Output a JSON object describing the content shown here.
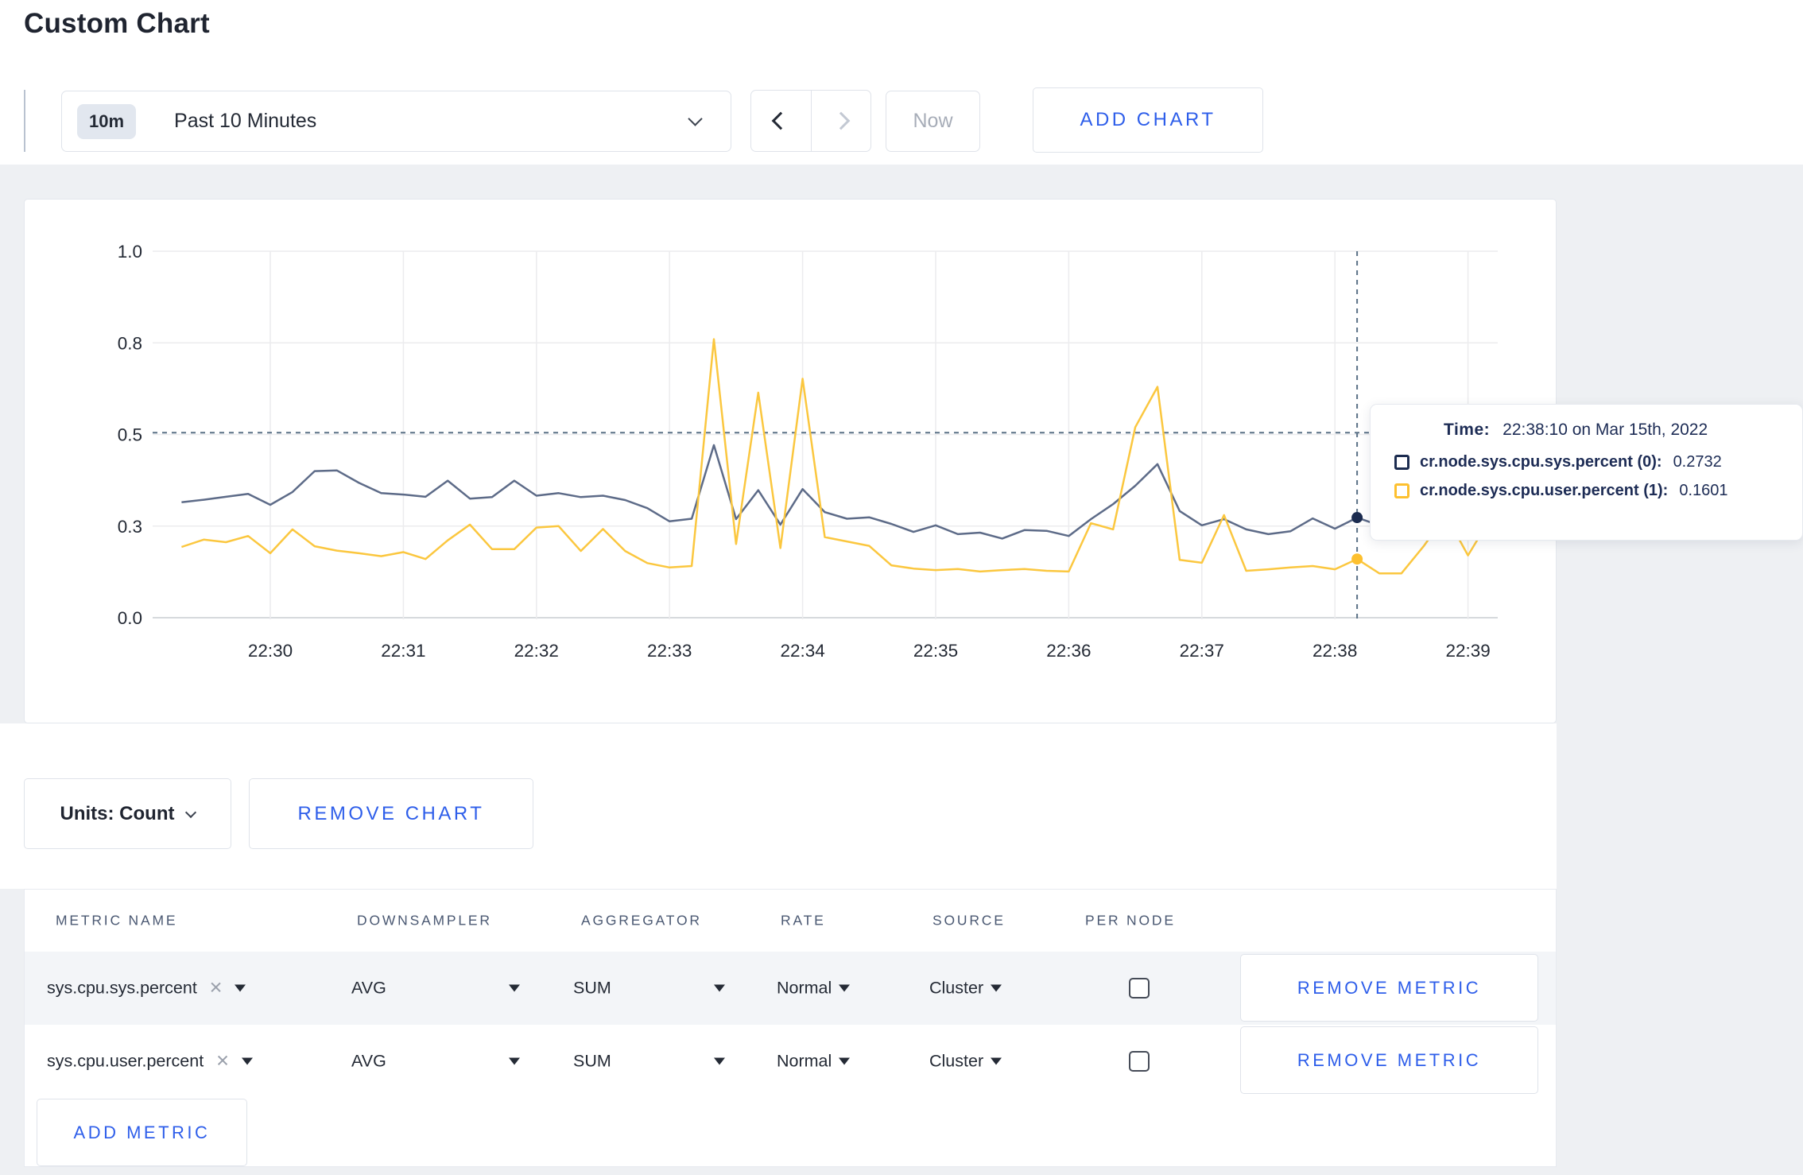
{
  "page": {
    "title": "Custom Chart"
  },
  "toolbar": {
    "range_badge": "10m",
    "range_label": "Past 10 Minutes",
    "now_label": "Now",
    "add_chart_label": "ADD CHART",
    "accent_color": "#2e5eea"
  },
  "chart_controls": {
    "units_label": "Units: Count",
    "remove_chart_label": "REMOVE CHART"
  },
  "tooltip": {
    "time_label": "Time:",
    "time_value": "22:38:10 on Mar 15th, 2022",
    "rows": [
      {
        "label": "cr.node.sys.cpu.sys.percent (0):",
        "value": "0.2732"
      },
      {
        "label": "cr.node.sys.cpu.user.percent (1):",
        "value": "0.1601"
      }
    ]
  },
  "metrics_table": {
    "headers": [
      "METRIC NAME",
      "DOWNSAMPLER",
      "AGGREGATOR",
      "RATE",
      "SOURCE",
      "PER NODE"
    ],
    "rows": [
      {
        "metric": "sys.cpu.sys.percent",
        "remove_icon": "✕",
        "downsampler": "AVG",
        "aggregator": "SUM",
        "rate": "Normal",
        "source": "Cluster",
        "per_node": false,
        "remove_label": "REMOVE METRIC"
      },
      {
        "metric": "sys.cpu.user.percent",
        "remove_icon": "✕",
        "downsampler": "AVG",
        "aggregator": "SUM",
        "rate": "Normal",
        "source": "Cluster",
        "per_node": false,
        "remove_label": "REMOVE METRIC"
      }
    ],
    "add_metric_label": "ADD METRIC"
  },
  "chart_data": {
    "type": "line",
    "title": "",
    "grid": true,
    "legend_position": "tooltip-overlay",
    "x_axis": {
      "tick_labels": [
        "22:30",
        "22:31",
        "22:32",
        "22:33",
        "22:34",
        "22:35",
        "22:36",
        "22:37",
        "22:38",
        "22:39"
      ],
      "start_time": "22:29:20",
      "end_time": "22:39:10",
      "sample_interval_seconds": 10
    },
    "y_axis": {
      "range": [
        0,
        1
      ],
      "tick_values": [
        0,
        0.25,
        0.5,
        0.75,
        1.0
      ],
      "tick_labels": [
        "0.0",
        "0.3",
        "0.5",
        "0.8",
        "1.0"
      ]
    },
    "crosshair": {
      "time": "22:38:10",
      "seconds_after_2230": 490,
      "h_line_value": 0.505,
      "color": "#5a7186"
    },
    "series": [
      {
        "name": "cr.node.sys.cpu.sys.percent",
        "node": "(0)",
        "color": "#5d6b88",
        "swatch_color": "#1c2c50",
        "hover_value": 0.2732,
        "values": [
          0.315,
          0.322,
          0.33,
          0.338,
          0.308,
          0.343,
          0.4,
          0.402,
          0.368,
          0.34,
          0.336,
          0.33,
          0.374,
          0.325,
          0.329,
          0.374,
          0.333,
          0.34,
          0.329,
          0.333,
          0.321,
          0.299,
          0.263,
          0.27,
          0.471,
          0.269,
          0.348,
          0.254,
          0.351,
          0.288,
          0.27,
          0.274,
          0.256,
          0.234,
          0.252,
          0.228,
          0.232,
          0.216,
          0.239,
          0.237,
          0.223,
          0.269,
          0.31,
          0.36,
          0.419,
          0.291,
          0.252,
          0.269,
          0.241,
          0.228,
          0.236,
          0.271,
          0.243,
          0.2732,
          0.252,
          0.258,
          0.266,
          0.274,
          0.27,
          0.272
        ]
      },
      {
        "name": "cr.node.sys.cpu.user.percent",
        "node": "(1)",
        "color": "#fbc73f",
        "swatch_color": "#fdc02f",
        "hover_value": 0.1601,
        "values": [
          0.193,
          0.213,
          0.206,
          0.223,
          0.176,
          0.241,
          0.195,
          0.183,
          0.176,
          0.168,
          0.179,
          0.16,
          0.211,
          0.254,
          0.187,
          0.187,
          0.246,
          0.25,
          0.182,
          0.242,
          0.182,
          0.149,
          0.137,
          0.141,
          0.76,
          0.201,
          0.614,
          0.19,
          0.652,
          0.22,
          0.208,
          0.196,
          0.143,
          0.134,
          0.13,
          0.133,
          0.126,
          0.13,
          0.133,
          0.128,
          0.126,
          0.258,
          0.241,
          0.52,
          0.63,
          0.158,
          0.15,
          0.28,
          0.128,
          0.132,
          0.137,
          0.141,
          0.132,
          0.1601,
          0.121,
          0.121,
          0.195,
          0.28,
          0.17,
          0.27
        ]
      }
    ]
  }
}
